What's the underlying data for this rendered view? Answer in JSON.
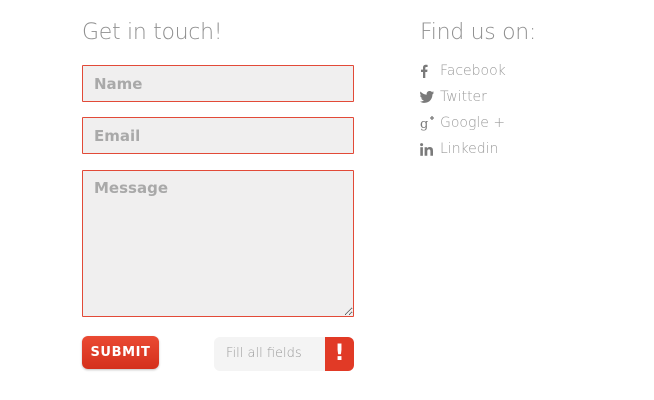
{
  "contact": {
    "heading": "Get in touch!",
    "name_placeholder": "Name",
    "email_placeholder": "Email",
    "message_placeholder": "Message",
    "submit_label": "SUBMIT",
    "status_text": "Fill all fields",
    "status_flag": "!"
  },
  "social": {
    "heading": "Find us on:",
    "items": [
      {
        "label": "Facebook",
        "icon": "facebook-icon"
      },
      {
        "label": "Twitter",
        "icon": "twitter-icon"
      },
      {
        "label": "Google +",
        "icon": "google-plus-icon"
      },
      {
        "label": "Linkedin",
        "icon": "linkedin-icon"
      }
    ]
  },
  "colors": {
    "accent": "#e24a38",
    "field_bg": "#f0efef",
    "text_muted": "#9b9b9b"
  }
}
